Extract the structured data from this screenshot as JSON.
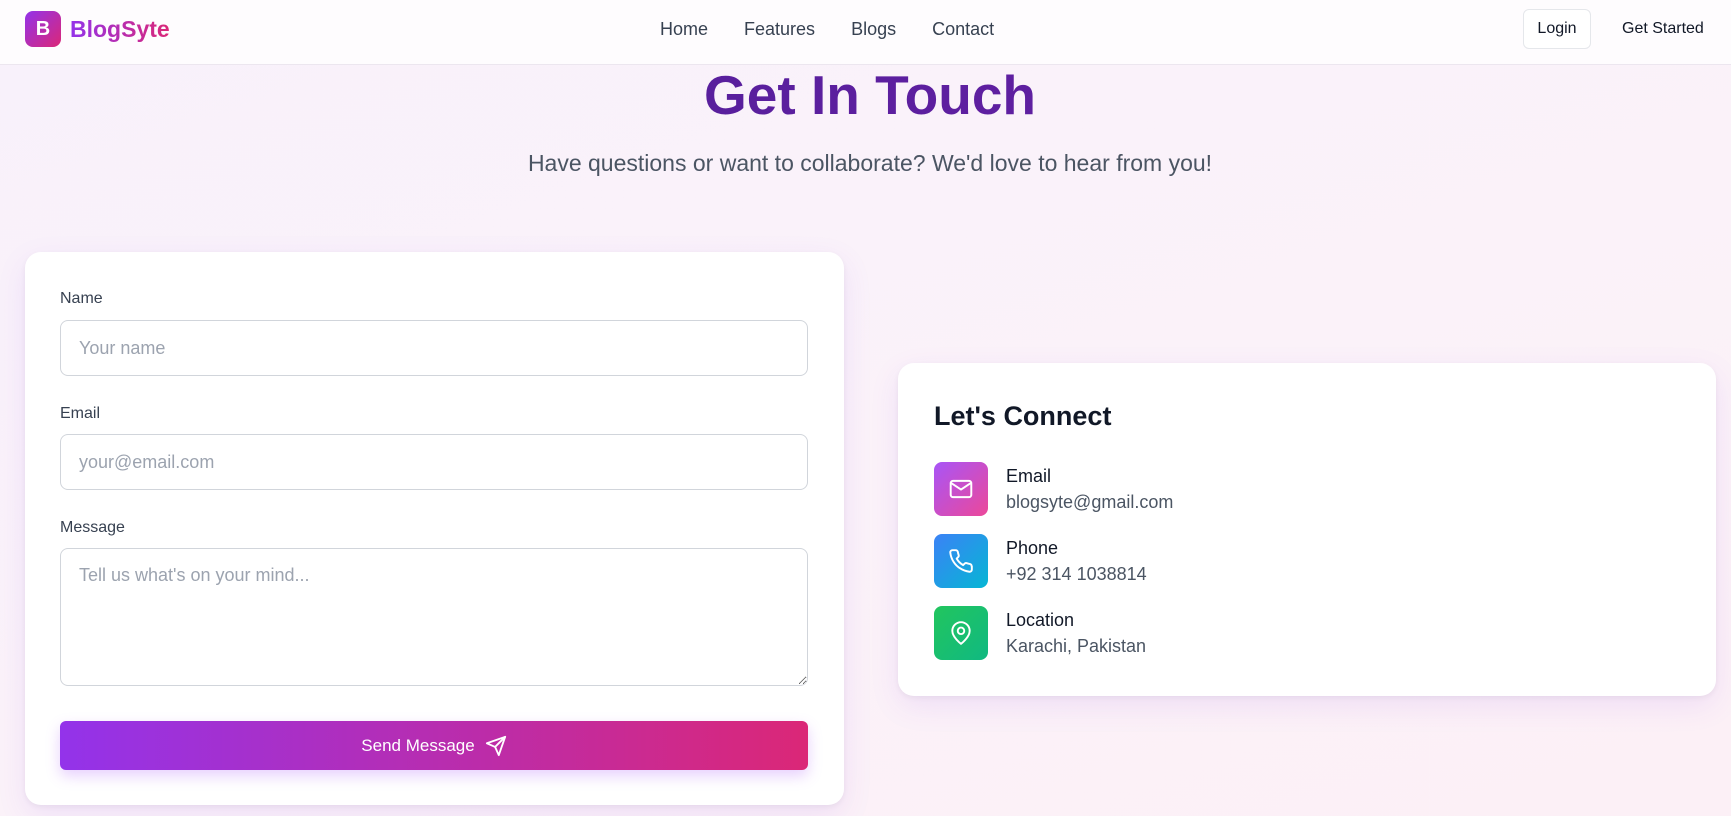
{
  "header": {
    "logo_letter": "B",
    "logo_text": "BlogSyte",
    "nav": [
      "Home",
      "Features",
      "Blogs",
      "Contact"
    ],
    "login_label": "Login",
    "get_started_label": "Get Started"
  },
  "hero": {
    "title": "Get In Touch",
    "subtitle": "Have questions or want to collaborate? We'd love to hear from you!"
  },
  "form": {
    "name_label": "Name",
    "name_placeholder": "Your name",
    "email_label": "Email",
    "email_placeholder": "your@email.com",
    "message_label": "Message",
    "message_placeholder": "Tell us what's on your mind...",
    "submit_label": "Send Message"
  },
  "connect": {
    "title": "Let's Connect",
    "items": [
      {
        "label": "Email",
        "value": "blogsyte@gmail.com",
        "icon": "mail-icon"
      },
      {
        "label": "Phone",
        "value": "+92 314 1038814",
        "icon": "phone-icon"
      },
      {
        "label": "Location",
        "value": "Karachi, Pakistan",
        "icon": "map-pin-icon"
      }
    ]
  },
  "colors": {
    "brand_purple": "#9333ea",
    "brand_pink": "#db2777",
    "title_purple": "#4c1d95",
    "phone_blue": "#3b82f6",
    "location_green": "#22c55e"
  }
}
